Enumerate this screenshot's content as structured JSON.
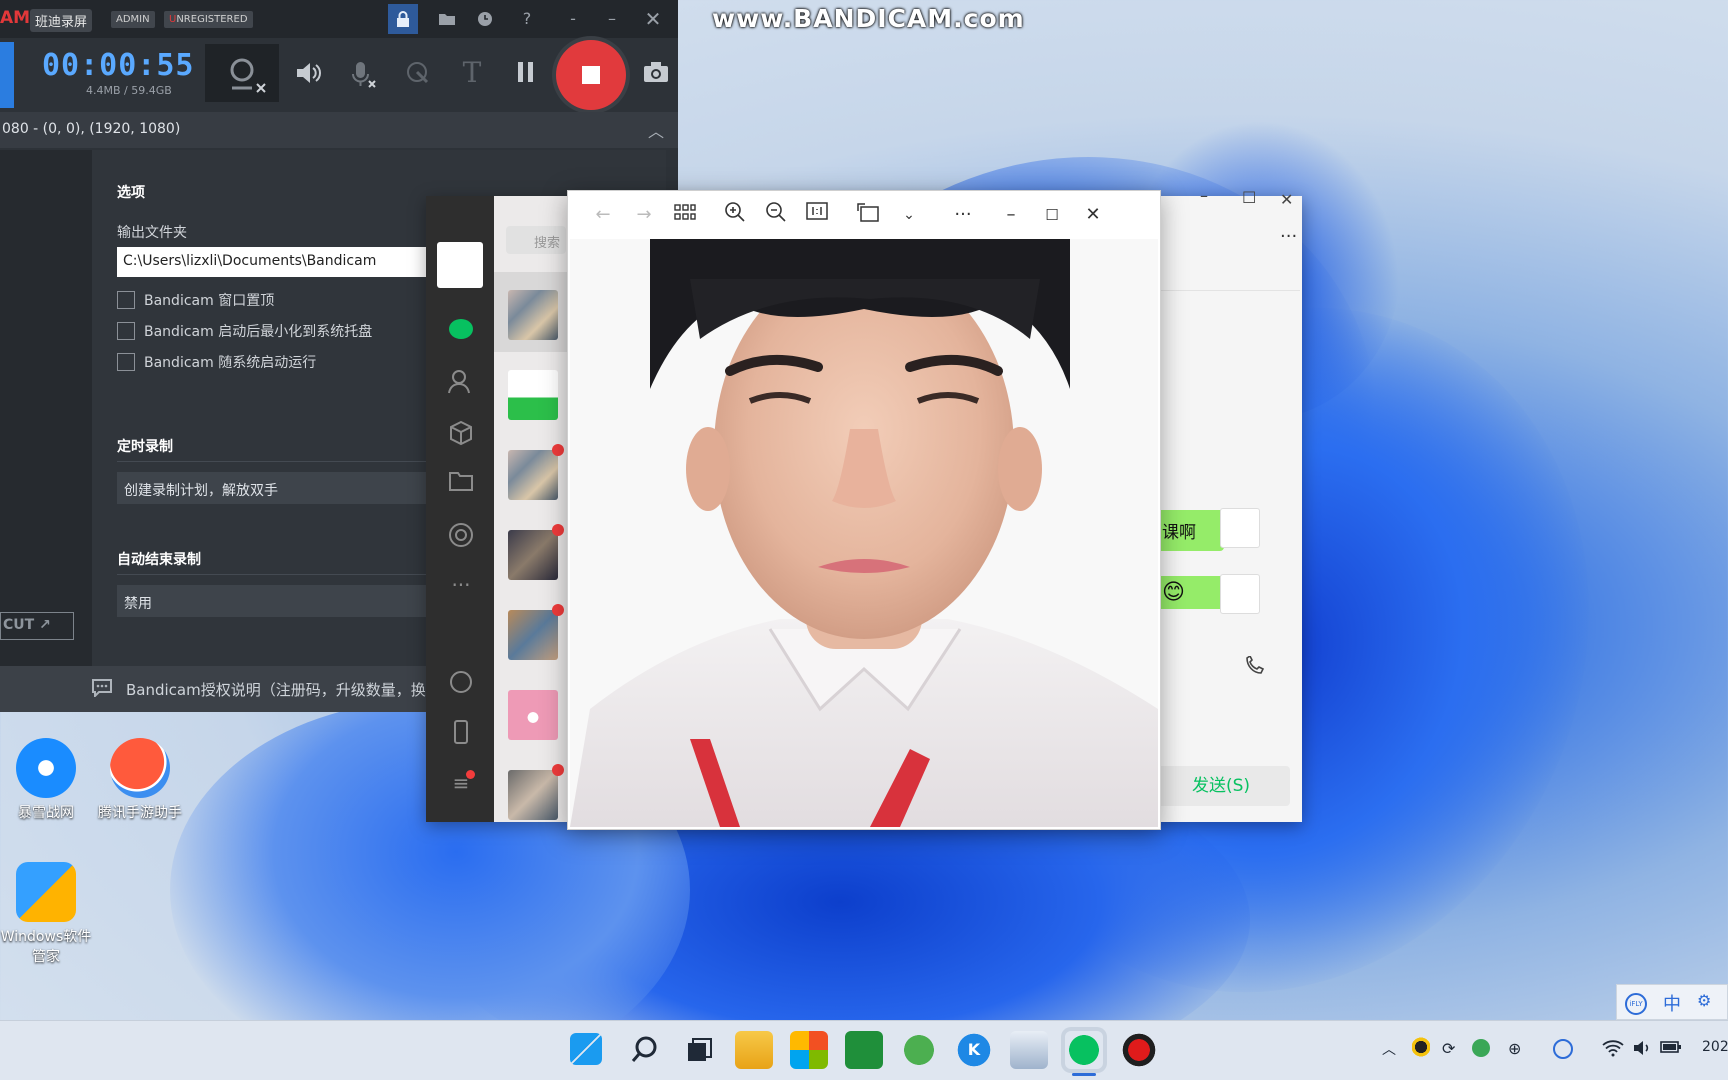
{
  "watermark": "www.BANDICAM.com",
  "bandicam": {
    "logo_fragment": "AM",
    "app_name": "班迪录屏",
    "admin_badge": "ADMIN",
    "unreg_u": "U",
    "unreg_rest": "NREGISTERED",
    "timer": "00:00:55",
    "file_size": "4.4MB / 59.4GB",
    "area_text": "080 - (0, 0), (1920, 1080)",
    "options_heading": "选项",
    "output_folder_label": "输出文件夹",
    "output_folder_value": "C:\\Users\\lizxli\\Documents\\Bandicam",
    "checkbox_topmost": "Bandicam 窗口置顶",
    "checkbox_minimize": "Bandicam 启动后最小化到系统托盘",
    "checkbox_autostart": "Bandicam 随系统启动运行",
    "scheduled_heading": "定时录制",
    "scheduled_value": "创建录制计划，解放双手",
    "autostop_heading": "自动结束录制",
    "autostop_value": "禁用",
    "cut_button": "CUT",
    "footer_text": "Bandicam授权说明（注册码，升级数量，换"
  },
  "desktop_icons": [
    {
      "label": "暴雪战网"
    },
    {
      "label": "腾讯手游助手"
    },
    {
      "label": "Windows软件管家"
    }
  ],
  "wechat": {
    "search_placeholder": "搜索",
    "messages": [
      {
        "text": "课啊"
      },
      {
        "text": "😊"
      }
    ],
    "send_button": "发送(S)"
  },
  "taskbar": {
    "ime_lang": "中",
    "clock_fragment": "202"
  },
  "colors": {
    "record_red": "#e13a3d",
    "timer_blue": "#5aa9ff",
    "wechat_green": "#95ec69"
  }
}
